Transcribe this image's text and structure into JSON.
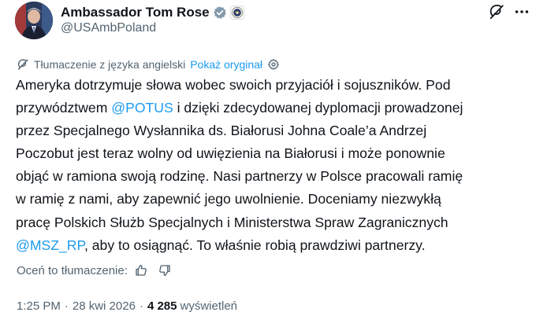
{
  "author": {
    "name": "Ambassador Tom Rose",
    "handle": "@USAmbPoland",
    "avatar_icon": "person-portrait-avatar",
    "verified_icon": "gray-verified-badge-icon",
    "affiliation_icon": "us-state-department-seal-icon"
  },
  "header_actions": {
    "grok_icon": "grok-icon",
    "more_icon": "more-options-icon"
  },
  "translation": {
    "translated_from": "Tłumaczenie z języka angielski",
    "show_original": "Pokaż oryginał",
    "settings_icon": "gear-icon"
  },
  "body": {
    "line1": "Ameryka dotrzymuje słowa wobec swoich przyjaciół i sojuszników. Pod",
    "line2_pre": "przywództwem ",
    "line2_mention": "@POTUS",
    "line2_post": " i dzięki zdecydowanej dyplomacji prowadzonej",
    "line3": "przez Specjalnego Wysłannika ds. Białorusi Johna Coale’a Andrzej",
    "line4": "Poczobut jest teraz wolny od uwięzienia na Białorusi i może ponownie",
    "line5": "objąć w ramiona swoją rodzinę. Nasi partnerzy w Polsce pracowali ramię",
    "line6": "w ramię z nami, aby zapewnić jego uwolnienie. Doceniamy niezwykłą",
    "line7": "pracę Polskich Służb Specjalnych i Ministerstwa Spraw Zagranicznych",
    "line8_mention": "@MSZ_RP",
    "line8_post": ", aby to osiągnąć. To właśnie robią prawdziwi partnerzy."
  },
  "rating": {
    "label": "Oceń to tłumaczenie:",
    "thumbs_up_icon": "thumbs-up-icon",
    "thumbs_down_icon": "thumbs-down-icon"
  },
  "meta": {
    "time": "1:25 PM",
    "separator": "·",
    "date": "28 kwi 2026",
    "views_count": "4 285",
    "views_label": "wyświetleń"
  },
  "colors": {
    "accent": "#1d9bf0",
    "text": "#0f1419",
    "secondary": "#536471"
  }
}
